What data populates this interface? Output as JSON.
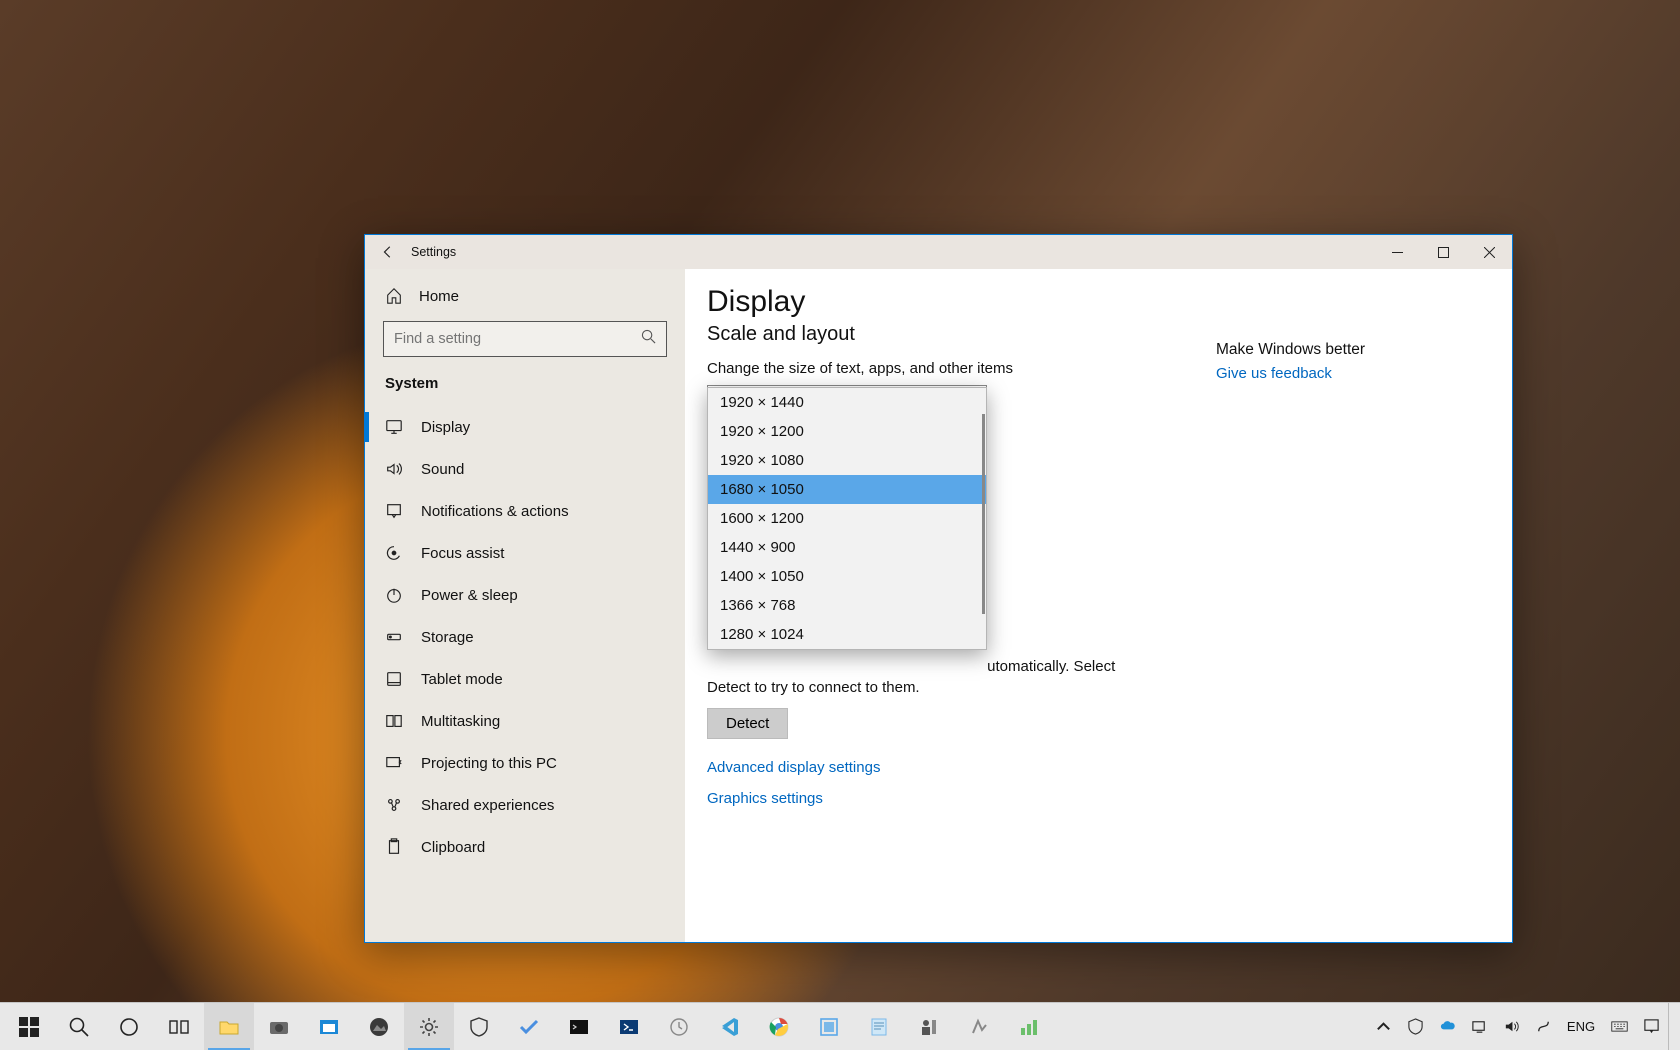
{
  "window": {
    "title": "Settings",
    "back_tooltip": "Back"
  },
  "sidebar": {
    "home_label": "Home",
    "search_placeholder": "Find a setting",
    "heading": "System",
    "items": [
      {
        "icon": "display",
        "label": "Display",
        "active": true
      },
      {
        "icon": "sound",
        "label": "Sound"
      },
      {
        "icon": "notifications",
        "label": "Notifications & actions"
      },
      {
        "icon": "focus",
        "label": "Focus assist"
      },
      {
        "icon": "power",
        "label": "Power & sleep"
      },
      {
        "icon": "storage",
        "label": "Storage"
      },
      {
        "icon": "tablet",
        "label": "Tablet mode"
      },
      {
        "icon": "multitasking",
        "label": "Multitasking"
      },
      {
        "icon": "projecting",
        "label": "Projecting to this PC"
      },
      {
        "icon": "shared",
        "label": "Shared experiences"
      },
      {
        "icon": "clipboard",
        "label": "Clipboard"
      }
    ]
  },
  "content": {
    "page_title": "Display",
    "section_title": "Scale and layout",
    "scale_label": "Change the size of text, apps, and other items",
    "resolution_options": [
      "1920 × 1440",
      "1920 × 1200",
      "1920 × 1080",
      "1680 × 1050",
      "1600 × 1200",
      "1440 × 900",
      "1400 × 1050",
      "1366 × 768",
      "1280 × 1024"
    ],
    "resolution_selected": "1680 × 1050",
    "multiple_displays_text_partial": "utomatically. Select Detect to try to connect to them.",
    "detect_label": "Detect",
    "link_advanced": "Advanced display settings",
    "link_graphics": "Graphics settings"
  },
  "side_pane": {
    "heading": "Make Windows better",
    "feedback_link": "Give us feedback"
  },
  "taskbar": {
    "tray_lang": "ENG"
  }
}
